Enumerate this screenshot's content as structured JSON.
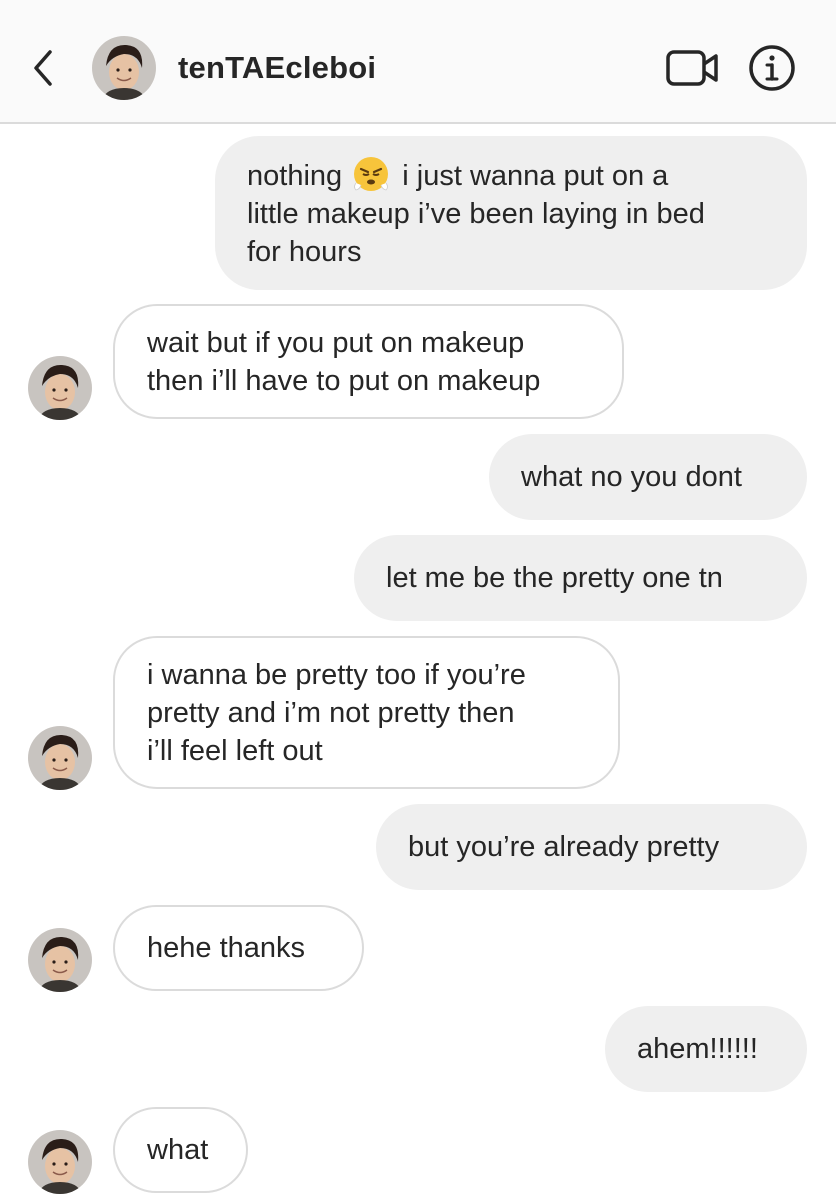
{
  "header": {
    "username": "tenTAEcleboi",
    "back_icon": "chevron-left-icon",
    "video_icon": "video-camera-icon",
    "info_icon": "info-icon"
  },
  "messages": [
    {
      "sender": "me",
      "lines": [
        "nothing",
        "i just wanna put on a",
        "little makeup i’ve been laying in bed",
        "for hours"
      ],
      "emoji": "frustrated-face-emoji"
    },
    {
      "sender": "them",
      "lines": [
        "wait but if you put on makeup",
        "then i’ll have to put on makeup"
      ]
    },
    {
      "sender": "me",
      "lines": [
        "what no you dont"
      ]
    },
    {
      "sender": "me",
      "lines": [
        "let me be the pretty one tn"
      ]
    },
    {
      "sender": "them",
      "lines": [
        "i wanna be pretty too if you’re",
        "pretty and i’m not pretty then",
        "i’ll feel left out"
      ]
    },
    {
      "sender": "me",
      "lines": [
        "but you’re already pretty"
      ]
    },
    {
      "sender": "them",
      "lines": [
        "hehe thanks"
      ]
    },
    {
      "sender": "me",
      "lines": [
        "ahem!!!!!!"
      ]
    },
    {
      "sender": "them",
      "lines": [
        "what"
      ]
    }
  ],
  "colors": {
    "sent_bubble": "#efefef",
    "received_border": "#dbdbdb",
    "text": "#262626",
    "header_bg": "#fafafa"
  }
}
